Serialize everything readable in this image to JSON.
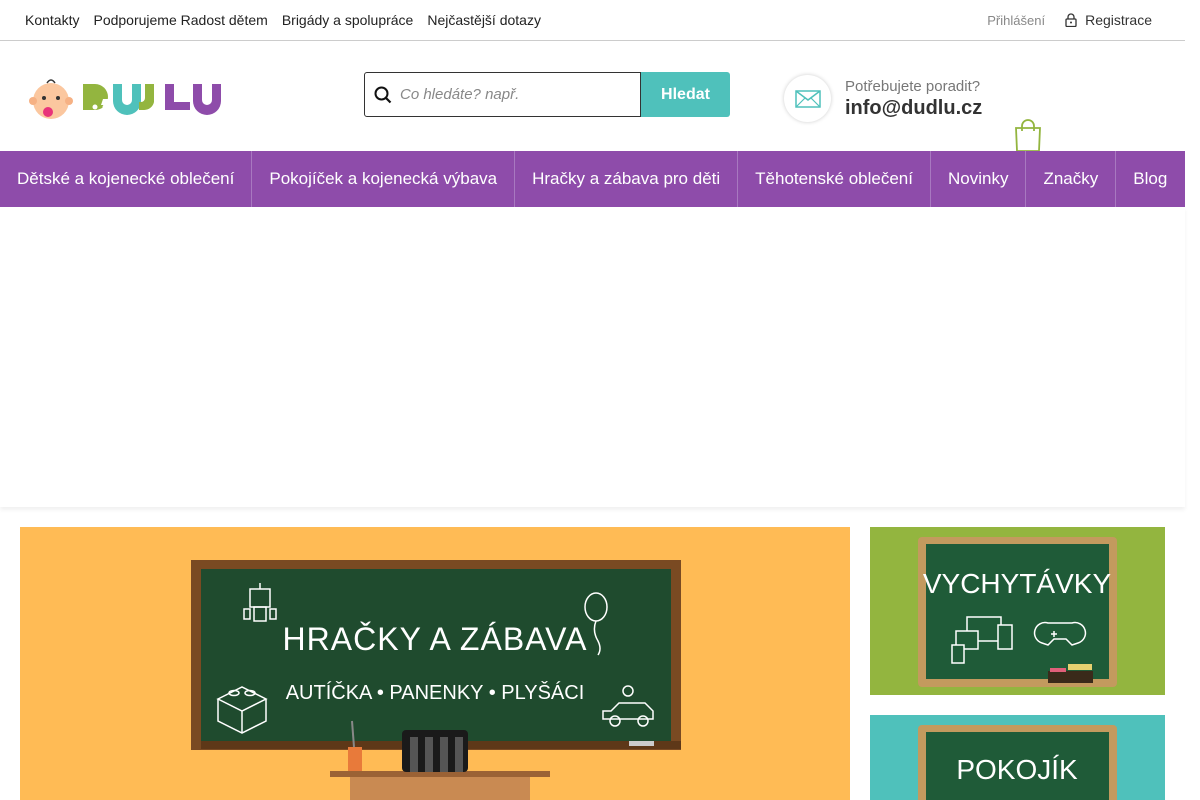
{
  "topbar": {
    "links": [
      "Kontakty",
      "Podporujeme Radost dětem",
      "Brigády a spolupráce",
      "Nejčastější dotazy"
    ],
    "login": "Přihlášení",
    "register": "Registrace"
  },
  "logo": {
    "text": "DUDLU"
  },
  "search": {
    "placeholder": "Co hledáte? např.",
    "button": "Hledat"
  },
  "contact": {
    "question": "Potřebujete poradit?",
    "email": "info@dudlu.cz"
  },
  "nav": {
    "items": [
      "Dětské a kojenecké oblečení",
      "Pokojíček a kojenecká výbava",
      "Hračky a zábava pro děti",
      "Těhotenské oblečení",
      "Novinky",
      "Značky",
      "Blog"
    ]
  },
  "banners": {
    "hero": {
      "title": "HRAČKY A ZÁBAVA",
      "subtitle": "AUTÍČKA • PANENKY • PLYŠÁCI"
    },
    "side1": {
      "title": "VYCHYTÁVKY"
    },
    "side2": {
      "title": "POKOJÍK"
    }
  },
  "colors": {
    "purple": "#8e4caa",
    "teal": "#4fc1bb",
    "green": "#93b53f",
    "orange": "#ffbb55",
    "board": "#1f4b2e"
  }
}
